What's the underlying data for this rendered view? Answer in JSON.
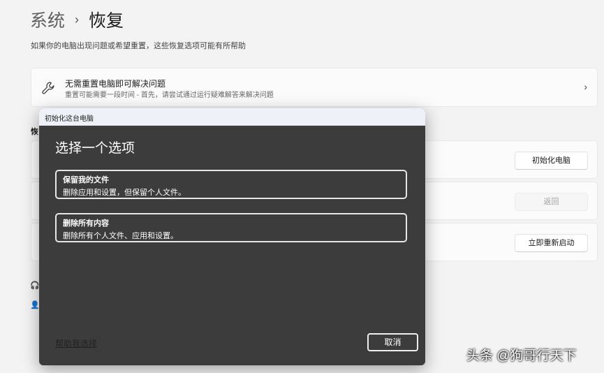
{
  "breadcrumb": {
    "parent": "系统",
    "separator": "›",
    "current": "恢复"
  },
  "description": "如果你的电脑出现问题或希望重置，这些恢复选项可能有所帮助",
  "troubleshoot_card": {
    "title": "无需重置电脑即可解决问题",
    "subtitle": "重置可能需要一段时间 - 首先，请尝试通过运行疑难解答来解决问题",
    "chevron": "›"
  },
  "section_label": "恢",
  "buttons": {
    "reset": "初始化电脑",
    "go_back": "返回",
    "restart": "立即重新启动"
  },
  "dialog": {
    "title": "初始化这台电脑",
    "heading": "选择一个选项",
    "options": [
      {
        "title": "保留我的文件",
        "desc": "删除应用和设置，但保留个人文件。"
      },
      {
        "title": "删除所有内容",
        "desc": "删除所有个人文件、应用和设置。"
      }
    ],
    "help_link": "帮助我选择",
    "cancel": "取消"
  },
  "watermark": "头条 @狗哥行天下"
}
